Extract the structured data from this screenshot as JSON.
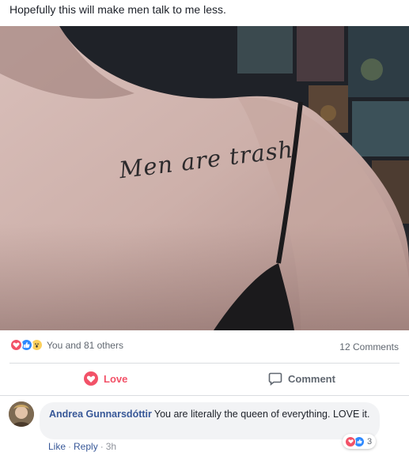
{
  "post": {
    "text": "Hopefully this will make men talk to me less.",
    "tattoo_text": "Men are trash"
  },
  "reactions": {
    "icons": [
      "love-icon",
      "like-icon",
      "wow-icon"
    ],
    "summary": "You and 81 others",
    "comments_count": "12 Comments"
  },
  "actions": {
    "love_label": "Love",
    "comment_label": "Comment"
  },
  "comment": {
    "author": "Andrea Gunnarsdóttir",
    "text": "You are literally the queen of everything. LOVE it.",
    "reaction_count": "3",
    "like_label": "Like",
    "reply_label": "Reply",
    "time": "3h"
  },
  "colors": {
    "love": "#f25268",
    "like": "#2e89ff",
    "link": "#385898"
  }
}
